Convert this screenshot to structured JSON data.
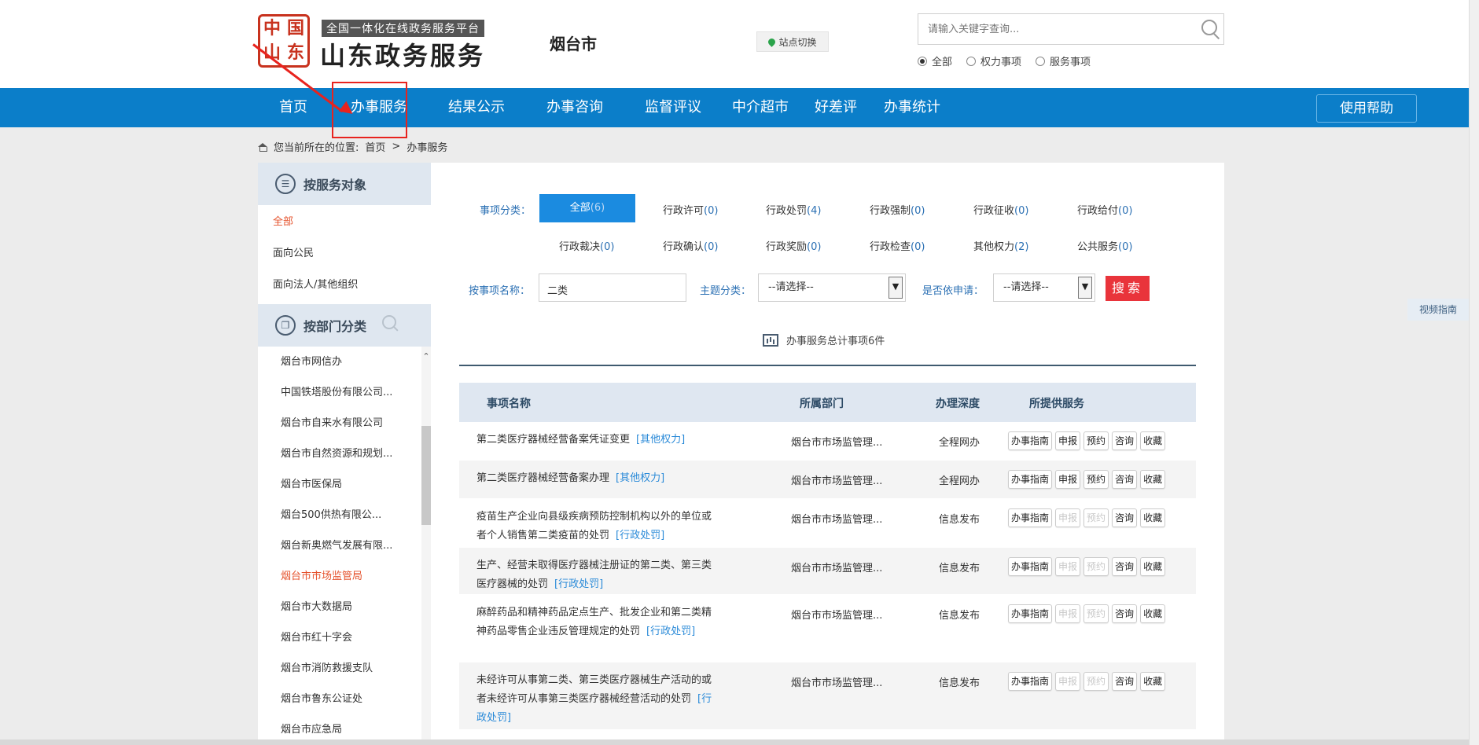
{
  "header": {
    "seal_chars": [
      "中",
      "国",
      "山",
      "东"
    ],
    "tagline": "全国一体化在线政务服务平台",
    "title": "山东政务服务",
    "city": "烟台市",
    "site_switch": "站点切换",
    "search_placeholder": "请输入关键字查询...",
    "radios": [
      {
        "label": "全部",
        "checked": true
      },
      {
        "label": "权力事项",
        "checked": false
      },
      {
        "label": "服务事项",
        "checked": false
      }
    ]
  },
  "nav": {
    "items": [
      "首页",
      "办事服务",
      "结果公示",
      "办事咨询",
      "监督评议",
      "中介超市",
      "好差评",
      "办事统计"
    ],
    "help": "使用帮助"
  },
  "breadcrumb": {
    "prefix": "您当前所在的位置:",
    "home": "首页",
    "sep": ">",
    "current": "办事服务"
  },
  "sidebar": {
    "by_target": {
      "title": "按服务对象",
      "items": [
        "全部",
        "面向公民",
        "面向法人/其他组织"
      ]
    },
    "by_dept": {
      "title": "按部门分类",
      "items": [
        "烟台市网信办",
        "中国铁塔股份有限公司...",
        "烟台市自来水有限公司",
        "烟台市自然资源和规划...",
        "烟台市医保局",
        "烟台500供热有限公...",
        "烟台新奥燃气发展有限...",
        "烟台市市场监管局",
        "烟台市大数据局",
        "烟台市红十字会",
        "烟台市消防救援支队",
        "烟台市鲁东公证处",
        "烟台市应急局"
      ],
      "active": "烟台市市场监管局"
    }
  },
  "categories": {
    "label": "事项分类：",
    "row1": [
      {
        "name": "全部",
        "count": "(6)"
      },
      {
        "name": "行政许可",
        "count": "(0)"
      },
      {
        "name": "行政处罚",
        "count": "(4)"
      },
      {
        "name": "行政强制",
        "count": "(0)"
      },
      {
        "name": "行政征收",
        "count": "(0)"
      },
      {
        "name": "行政给付",
        "count": "(0)"
      }
    ],
    "row2": [
      {
        "name": "行政裁决",
        "count": "(0)"
      },
      {
        "name": "行政确认",
        "count": "(0)"
      },
      {
        "name": "行政奖励",
        "count": "(0)"
      },
      {
        "name": "行政检查",
        "count": "(0)"
      },
      {
        "name": "其他权力",
        "count": "(2)"
      },
      {
        "name": "公共服务",
        "count": "(0)"
      }
    ]
  },
  "filters": {
    "name_label": "按事项名称：",
    "name_value": "二类",
    "theme_label": "主题分类：",
    "theme_value": "--请选择--",
    "apply_label": "是否依申请：",
    "apply_value": "--请选择--",
    "search_btn": "搜索"
  },
  "total": "办事服务总计事项6件",
  "table": {
    "headers": [
      "事项名称",
      "所属部门",
      "办理深度",
      "所提供服务"
    ],
    "rows": [
      {
        "name": "第二类医疗器械经营备案凭证变更",
        "tag": "[其他权力]",
        "dept": "烟台市市场监管理...",
        "depth": "全程网办",
        "services": [
          "办事指南",
          "申报",
          "预约",
          "咨询",
          "收藏"
        ],
        "disabled": [
          false,
          false,
          false,
          false,
          false
        ]
      },
      {
        "name": "第二类医疗器械经营备案办理",
        "tag": "[其他权力]",
        "dept": "烟台市市场监管理...",
        "depth": "全程网办",
        "services": [
          "办事指南",
          "申报",
          "预约",
          "咨询",
          "收藏"
        ],
        "disabled": [
          false,
          false,
          false,
          false,
          false
        ]
      },
      {
        "name": "疫苗生产企业向县级疾病预防控制机构以外的单位或者个人销售第二类疫苗的处罚",
        "tag": "[行政处罚]",
        "dept": "烟台市市场监管理...",
        "depth": "信息发布",
        "services": [
          "办事指南",
          "申报",
          "预约",
          "咨询",
          "收藏"
        ],
        "disabled": [
          false,
          true,
          true,
          false,
          false
        ]
      },
      {
        "name": "生产、经营未取得医疗器械注册证的第二类、第三类医疗器械的处罚",
        "tag": "[行政处罚]",
        "dept": "烟台市市场监管理...",
        "depth": "信息发布",
        "services": [
          "办事指南",
          "申报",
          "预约",
          "咨询",
          "收藏"
        ],
        "disabled": [
          false,
          true,
          true,
          false,
          false
        ]
      },
      {
        "name": "麻醉药品和精神药品定点生产、批发企业和第二类精神药品零售企业违反管理规定的处罚",
        "tag": "[行政处罚]",
        "dept": "烟台市市场监管理...",
        "depth": "信息发布",
        "services": [
          "办事指南",
          "申报",
          "预约",
          "咨询",
          "收藏"
        ],
        "disabled": [
          false,
          true,
          true,
          false,
          false
        ]
      },
      {
        "name": "未经许可从事第二类、第三类医疗器械生产活动的或者未经许可从事第三类医疗器械经营活动的处罚",
        "tag": "[行政处罚]",
        "dept": "烟台市市场监管理...",
        "depth": "信息发布",
        "services": [
          "办事指南",
          "申报",
          "预约",
          "咨询",
          "收藏"
        ],
        "disabled": [
          false,
          true,
          true,
          false,
          false
        ]
      }
    ]
  },
  "side_float": "视频指南",
  "colors": {
    "nav": "#0b7ec9",
    "accent": "#1b8be0",
    "search_btn": "#e9343b",
    "active_link": "#e5532d",
    "annotation": "#e8231e"
  }
}
